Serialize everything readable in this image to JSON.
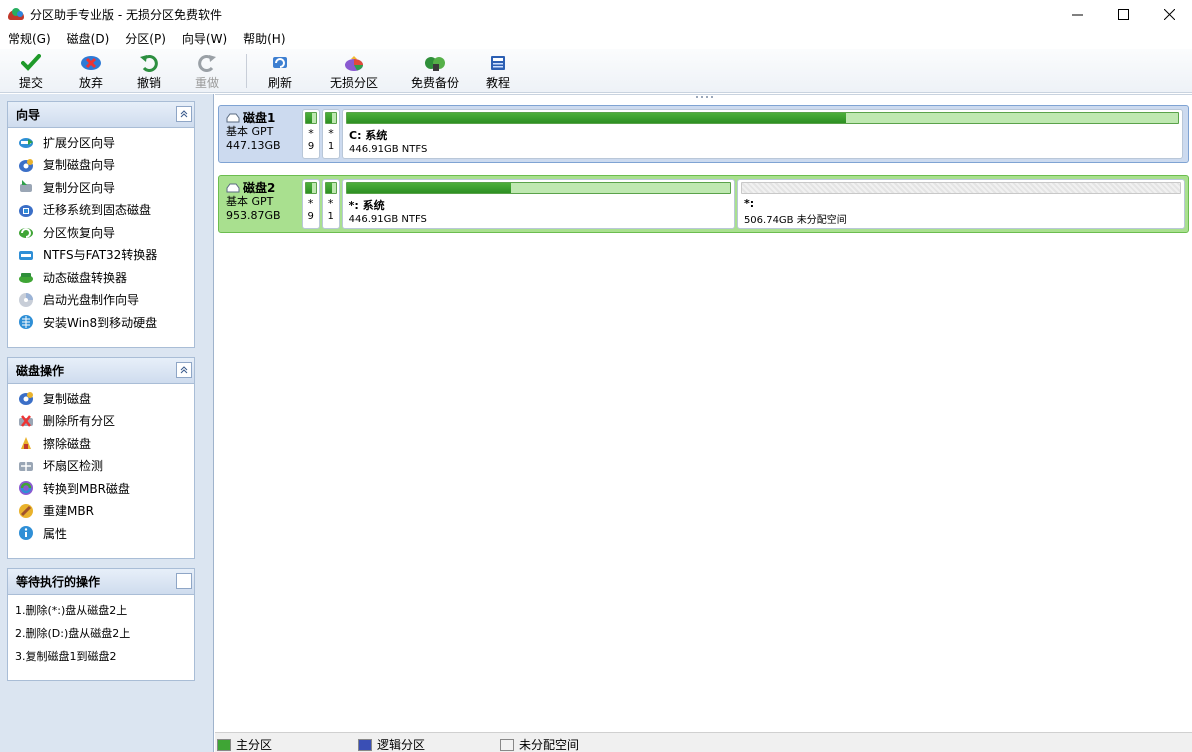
{
  "window": {
    "title": "分区助手专业版 - 无损分区免费软件"
  },
  "menu": [
    "常规(G)",
    "磁盘(D)",
    "分区(P)",
    "向导(W)",
    "帮助(H)"
  ],
  "toolbar": {
    "commit": "提交",
    "discard": "放弃",
    "undo": "撤销",
    "redo": "重做",
    "refresh": "刷新",
    "lossless": "无损分区",
    "backup": "免费备份",
    "tutorial": "教程"
  },
  "wizard_panel": {
    "title": "向导",
    "items": [
      {
        "label": "扩展分区向导",
        "icon": "extend-partition-icon"
      },
      {
        "label": "复制磁盘向导",
        "icon": "copy-disk-icon"
      },
      {
        "label": "复制分区向导",
        "icon": "copy-partition-icon"
      },
      {
        "label": "迁移系统到固态磁盘",
        "icon": "migrate-os-icon"
      },
      {
        "label": "分区恢复向导",
        "icon": "partition-recovery-icon"
      },
      {
        "label": "NTFS与FAT32转换器",
        "icon": "ntfs-fat32-icon"
      },
      {
        "label": "动态磁盘转换器",
        "icon": "dynamic-disk-icon"
      },
      {
        "label": "启动光盘制作向导",
        "icon": "bootable-cd-icon"
      },
      {
        "label": "安装Win8到移动硬盘",
        "icon": "windows-to-go-icon"
      }
    ]
  },
  "disk_ops_panel": {
    "title": "磁盘操作",
    "items": [
      {
        "label": "复制磁盘",
        "icon": "copy-disk-icon"
      },
      {
        "label": "删除所有分区",
        "icon": "delete-partitions-icon"
      },
      {
        "label": "擦除磁盘",
        "icon": "wipe-disk-icon"
      },
      {
        "label": "坏扇区检测",
        "icon": "bad-sector-icon"
      },
      {
        "label": "转换到MBR磁盘",
        "icon": "convert-mbr-icon"
      },
      {
        "label": "重建MBR",
        "icon": "rebuild-mbr-icon"
      },
      {
        "label": "属性",
        "icon": "properties-icon"
      }
    ]
  },
  "pending_panel": {
    "title": "等待执行的操作",
    "items": [
      "1.删除(*:)盘从磁盘2上",
      "2.删除(D:)盘从磁盘2上",
      "3.复制磁盘1到磁盘2"
    ]
  },
  "disks": [
    {
      "name": "磁盘1",
      "type": "基本 GPT",
      "size": "447.13GB",
      "small_parts": [
        {
          "star": "*",
          "num": "9",
          "used": 0.6
        },
        {
          "star": "*",
          "num": "1",
          "used": 0.6
        }
      ],
      "partitions": [
        {
          "label": "C: 系统",
          "detail": "446.91GB NTFS",
          "used": 0.6
        }
      ]
    },
    {
      "name": "磁盘2",
      "type": "基本 GPT",
      "size": "953.87GB",
      "small_parts": [
        {
          "star": "*",
          "num": "9",
          "used": 0.6
        },
        {
          "star": "*",
          "num": "1",
          "used": 0.6
        }
      ],
      "partitions": [
        {
          "label": "*: 系统",
          "detail": "446.91GB NTFS",
          "used": 0.43
        },
        {
          "label": "*:",
          "detail": "506.74GB 未分配空间",
          "used": 0
        }
      ]
    }
  ],
  "legend": {
    "primary": "主分区",
    "logical": "逻辑分区",
    "unallocated": "未分配空间"
  },
  "colors": {
    "primary": "#3fa535",
    "logical": "#3a4fb5",
    "unallocated": "#f2f2f2"
  }
}
